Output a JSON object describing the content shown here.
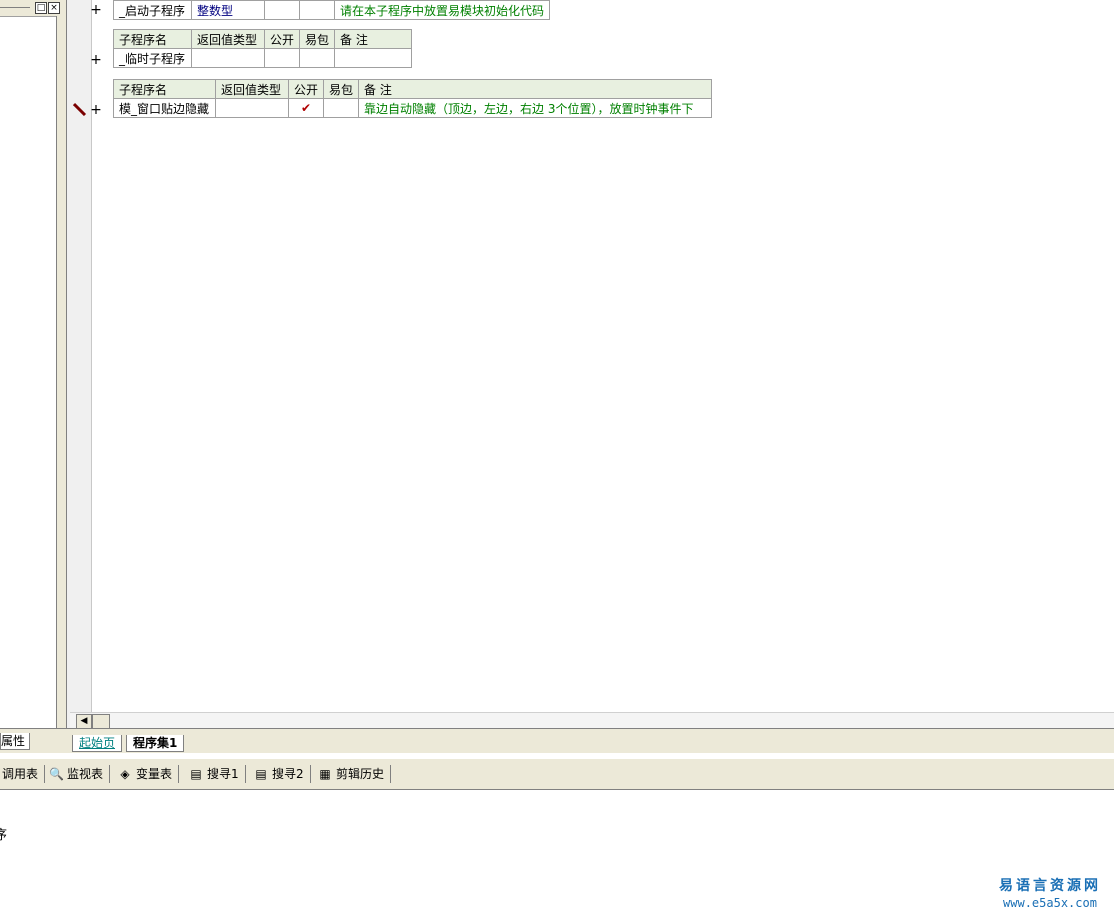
{
  "left_panel": {
    "restore_glyph": "□",
    "close_glyph": "×",
    "properties_tab": "属性"
  },
  "tables": {
    "startup": {
      "name": "_启动子程序",
      "return_type": "整数型",
      "public": "",
      "easy_pack": "",
      "note": "请在本子程序中放置易模块初始化代码"
    },
    "temp": {
      "headers": [
        "子程序名",
        "返回值类型",
        "公开",
        "易包",
        "备 注"
      ],
      "name": "_临时子程序",
      "return_type": "",
      "public": "",
      "easy_pack": "",
      "note": ""
    },
    "hide": {
      "headers": [
        "子程序名",
        "返回值类型",
        "公开",
        "易包",
        "备 注"
      ],
      "name": "模_窗口贴边隐藏",
      "return_type": "",
      "public": "✔",
      "easy_pack": "",
      "note": "靠边自动隐藏（顶边，左边，右边  3个位置），放置时钟事件下"
    }
  },
  "gutter": {
    "expand_glyph": "+"
  },
  "editor_tabs": {
    "start_page": "起始页",
    "program_set": "程序集1"
  },
  "toolstrip": {
    "items": [
      {
        "label": "调用表",
        "icon": ""
      },
      {
        "label": "监视表",
        "icon": "🔍"
      },
      {
        "label": "变量表",
        "icon": "◈"
      },
      {
        "label": "搜寻1",
        "icon": "▤"
      },
      {
        "label": "搜寻2",
        "icon": "▤"
      },
      {
        "label": "剪辑历史",
        "icon": "▦"
      }
    ]
  },
  "output": {
    "text": "序"
  },
  "watermark": {
    "line1": "易语言资源网",
    "line2": "www.e5a5x.com",
    "color": "#1a6fb5"
  }
}
